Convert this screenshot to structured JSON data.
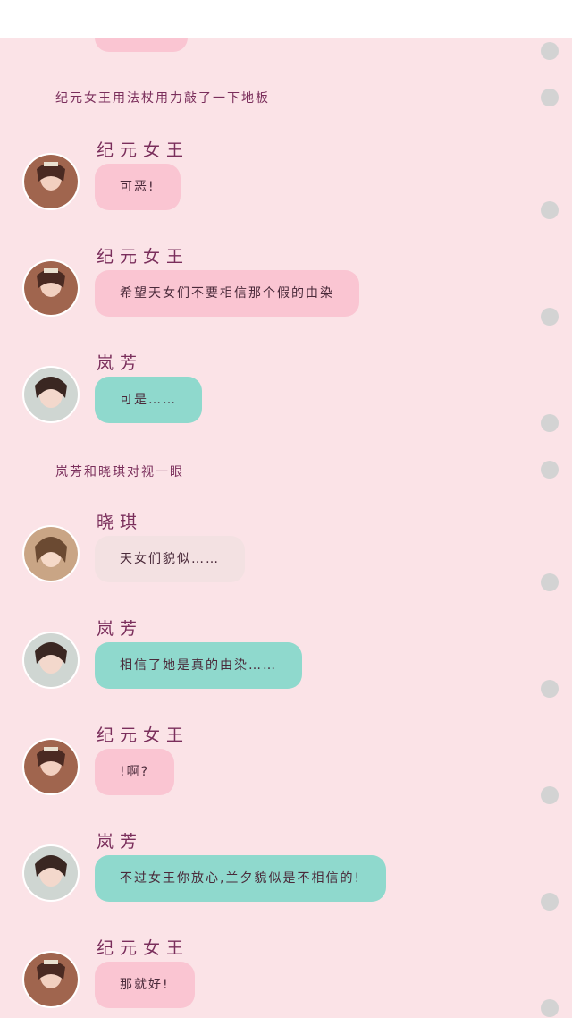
{
  "messages": [
    {
      "type": "narration",
      "text": "纪元女王用法杖用力敲了一下地板"
    },
    {
      "type": "message",
      "speaker": "纪元女王",
      "avatar": "queen-avatar",
      "style": "pink",
      "text": "可恶!"
    },
    {
      "type": "message",
      "speaker": "纪元女王",
      "avatar": "queen-avatar",
      "style": "pink",
      "text": "希望天女们不要相信那个假的由染"
    },
    {
      "type": "message",
      "speaker": "岚芳",
      "avatar": "lanfang-avatar",
      "style": "teal",
      "text": "可是……"
    },
    {
      "type": "narration",
      "text": "岚芳和晓琪对视一眼"
    },
    {
      "type": "message",
      "speaker": "晓琪",
      "avatar": "xiaoqi-avatar",
      "style": "beige",
      "text": "天女们貌似……"
    },
    {
      "type": "message",
      "speaker": "岚芳",
      "avatar": "lanfang-avatar",
      "style": "teal",
      "text": "相信了她是真的由染……"
    },
    {
      "type": "message",
      "speaker": "纪元女王",
      "avatar": "queen-avatar",
      "style": "pink",
      "text": "!啊?"
    },
    {
      "type": "message",
      "speaker": "岚芳",
      "avatar": "lanfang-avatar",
      "style": "teal",
      "text": "不过女王你放心,兰夕貌似是不相信的!"
    },
    {
      "type": "message",
      "speaker": "纪元女王",
      "avatar": "queen-avatar",
      "style": "pink",
      "text": "那就好!"
    }
  ],
  "colors": {
    "background": "#fbe3e7",
    "name_text": "#7a2e5b",
    "bubble_pink": "#fac5d2",
    "bubble_teal": "#8fd9cd",
    "bubble_beige": "#f3e1e2",
    "scroll_dot": "#d3d3d3"
  }
}
